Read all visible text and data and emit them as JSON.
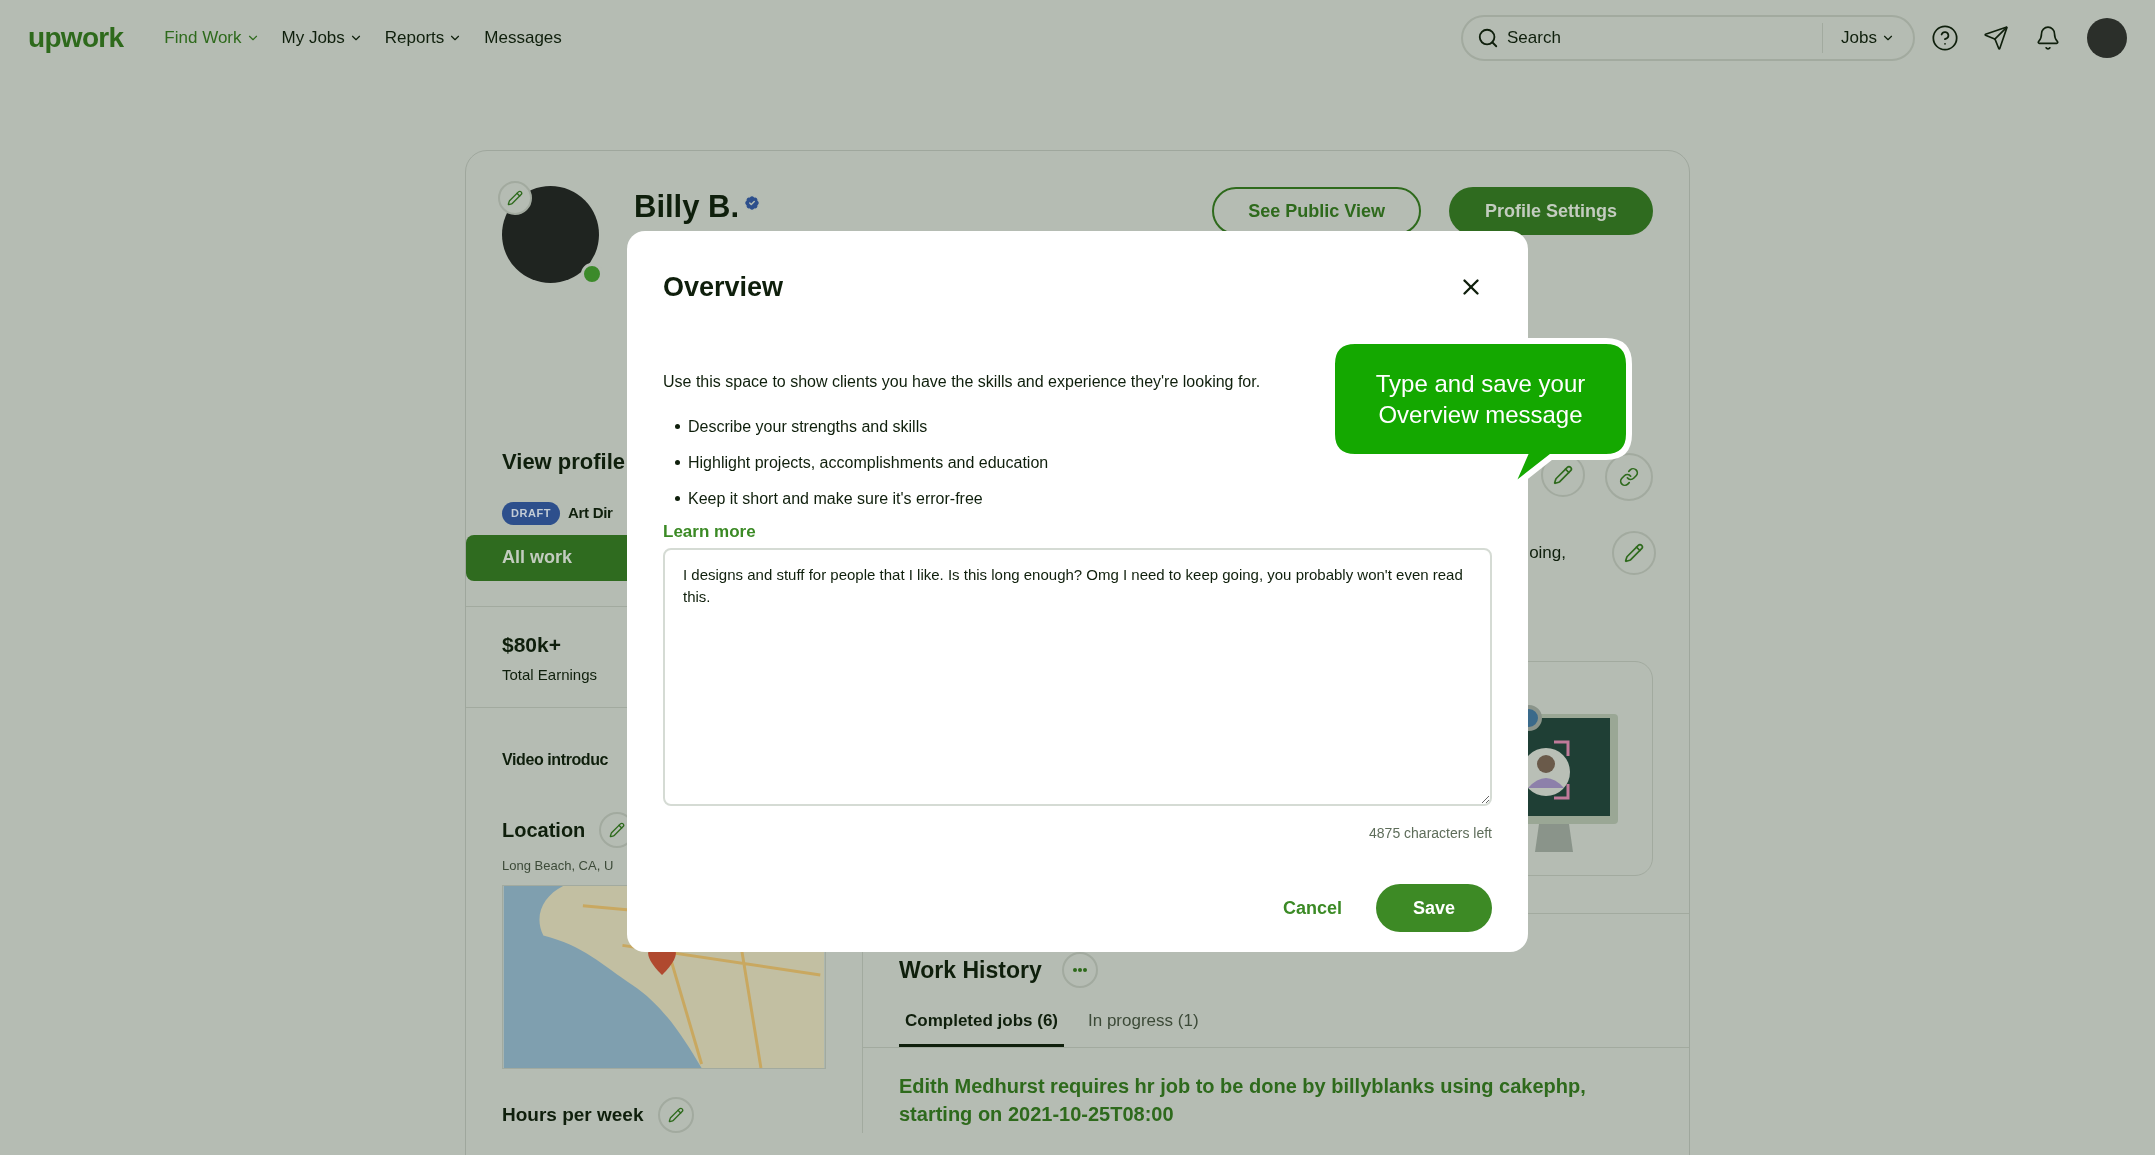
{
  "nav": {
    "logo": "upwork",
    "items": [
      {
        "label": "Find Work",
        "selected": true,
        "dropdown": true
      },
      {
        "label": "My Jobs",
        "selected": false,
        "dropdown": true
      },
      {
        "label": "Reports",
        "selected": false,
        "dropdown": true
      },
      {
        "label": "Messages",
        "selected": false,
        "dropdown": false
      }
    ]
  },
  "search": {
    "placeholder": "Search",
    "scope": "Jobs"
  },
  "profile": {
    "name": "Billy B.",
    "verified": true,
    "online": true,
    "buttons": [
      "See Public View",
      "Profile Settings"
    ]
  },
  "left": {
    "view_profile": "View profile",
    "draft_badge": "DRAFT",
    "specialization": "Art Dir",
    "all_work": "All work",
    "earnings": "$80k+",
    "earnings_label": "Total Earnings",
    "video_heading": "Video introduc",
    "location_heading": "Location",
    "location": "Long Beach, CA, U",
    "hours_heading": "Hours per week"
  },
  "right": {
    "overview_snippet": "oing,",
    "work_history": {
      "title": "Work History",
      "tabs": [
        {
          "label": "Completed jobs (6)",
          "selected": true
        },
        {
          "label": "In progress (1)",
          "selected": false
        }
      ],
      "jobs": [
        "Edith Medhurst requires hr job to be done by billyblanks using cakephp, starting on 2021-10-25T08:00"
      ]
    }
  },
  "modal": {
    "title": "Overview",
    "intro": "Use this space to show clients you have the skills and experience they're looking for.",
    "tips": [
      "Describe your strengths and skills",
      "Highlight projects, accomplishments and education",
      "Keep it short and make sure it's error-free"
    ],
    "learn_more": "Learn more",
    "value": "I designs and stuff for people that I like. Is this long enough? Omg I need to keep going, you probably won't even read this.",
    "counter": "4875 characters left",
    "cancel": "Cancel",
    "save": "Save"
  },
  "callout": {
    "lines": [
      "Type and save your",
      "Overview message"
    ]
  }
}
